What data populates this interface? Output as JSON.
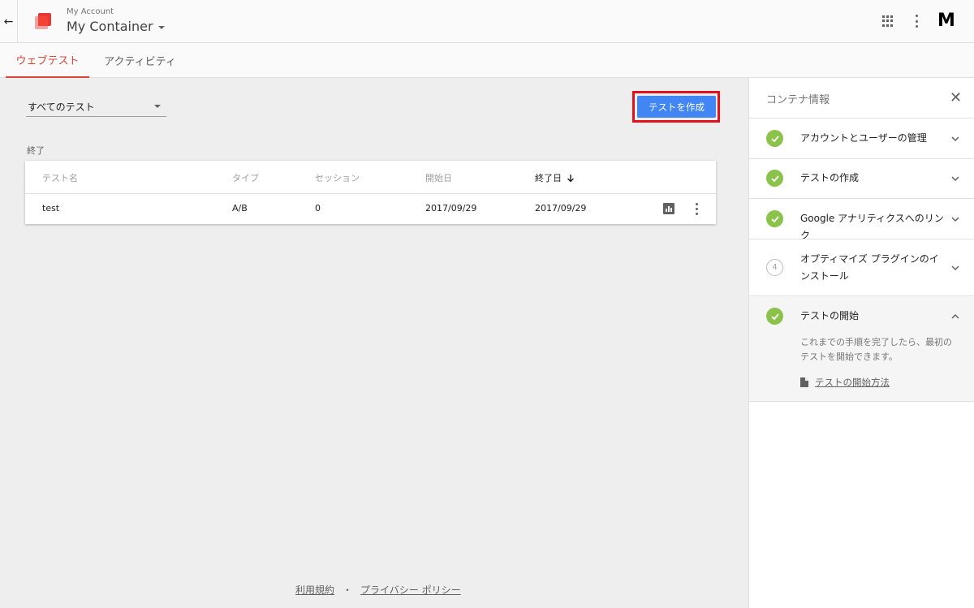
{
  "header": {
    "back_icon": "arrow-left-icon",
    "account": "My Account",
    "container": "My Container",
    "avatar_letter": "M"
  },
  "tabs": [
    {
      "label": "ウェブテスト",
      "active": true
    },
    {
      "label": "アクティビティ",
      "active": false
    }
  ],
  "filter": {
    "selected": "すべてのテスト"
  },
  "create_button": {
    "label": "テストを作成",
    "highlight_color": "#e3111c",
    "color": "#4285f4"
  },
  "section": {
    "label": "終了"
  },
  "table": {
    "columns": [
      "テスト名",
      "タイプ",
      "セッション",
      "開始日",
      "終了日"
    ],
    "sorted_column": "終了日",
    "rows": [
      {
        "name": "test",
        "type": "A/B",
        "sessions": "0",
        "start": "2017/09/29",
        "end": "2017/09/29"
      }
    ]
  },
  "footer": {
    "terms": "利用規約",
    "separator": "・",
    "privacy": "プライバシー ポリシー"
  },
  "panel": {
    "title": "コンテナ情報",
    "steps": [
      {
        "label": "アカウントとユーザーの管理",
        "status": "done",
        "expanded": false
      },
      {
        "label": "テストの作成",
        "status": "done",
        "expanded": false
      },
      {
        "label": "Google アナリティクスへのリンク",
        "status": "done",
        "expanded": false
      },
      {
        "label": "オプティマイズ プラグインのインストール",
        "status": "pending",
        "number": "4",
        "expanded": false
      },
      {
        "label": "テストの開始",
        "status": "done",
        "expanded": true,
        "body": "これまでの手順を完了したら、最初のテストを開始できます。",
        "link": "テストの開始方法"
      }
    ],
    "done_color": "#8bc34a"
  }
}
